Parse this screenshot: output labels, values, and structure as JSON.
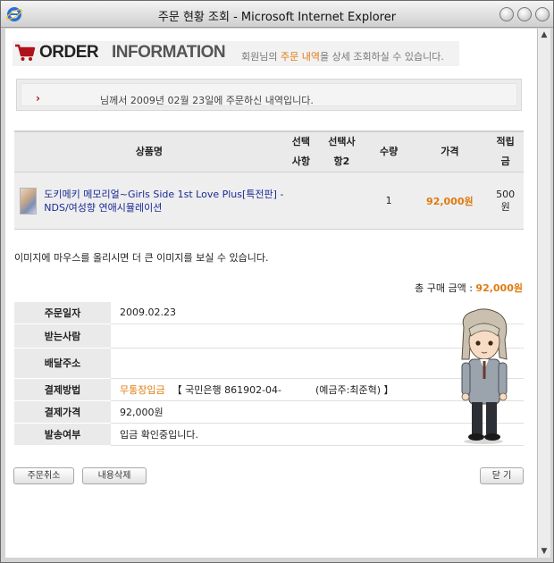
{
  "window": {
    "title": "주문 현황 조회 - Microsoft Internet Explorer"
  },
  "header": {
    "order_word": "ORDER",
    "information_word": "INFORMATION",
    "subtitle_pre": "회원님의 ",
    "subtitle_highlight": "주문 내역",
    "subtitle_post": "을 상세 조회하실 수 있습니다."
  },
  "notice": {
    "text": "님께서 2009년 02월 23일에 주문하신 내역입니다."
  },
  "product_table": {
    "headers": {
      "name": "상품명",
      "option1_line1": "선택",
      "option1_line2": "사항",
      "option2_line1": "선택사",
      "option2_line2": "항2",
      "qty": "수량",
      "price": "가격",
      "points_line1": "적립",
      "points_line2": "금"
    },
    "rows": [
      {
        "name": "도키메키 메모리얼~Girls Side 1st Love Plus[특전판] - NDS/여성향 연애시뮬레이션",
        "option1": "",
        "option2": "",
        "qty": "1",
        "price": "92,000원",
        "points_line1": "500",
        "points_line2": "원"
      }
    ]
  },
  "hover_note": "이미지에 마우스를 올리시면 더 큰 이미지를 보실 수 있습니다.",
  "total": {
    "label": "총 구매 금액 : ",
    "amount": "92,000원"
  },
  "info": {
    "order_date_label": "주문일자",
    "order_date": "2009.02.23",
    "recipient_label": "받는사람",
    "recipient": "",
    "address_label": "배달주소",
    "address": "",
    "payment_method_label": "결제방법",
    "payment_method": "무통장입금",
    "bank_info": "【 국민은행 861902-04-",
    "holder_info": "(예금주:최준혁) 】",
    "payment_amount_label": "결제가격",
    "payment_amount": "92,000원",
    "shipping_status_label": "발송여부",
    "shipping_status": "입금 확인중입니다."
  },
  "buttons": {
    "cancel_order": "주문취소",
    "delete_content": "내용삭제",
    "close": "닫 기"
  },
  "colors": {
    "accent_orange": "#e07a10",
    "link_blue": "#1a2a96",
    "cart_red": "#b0121b"
  },
  "icons": [
    "ie-icon",
    "cart-icon",
    "arrow-icon",
    "product-thumbnail",
    "character-illustration"
  ]
}
